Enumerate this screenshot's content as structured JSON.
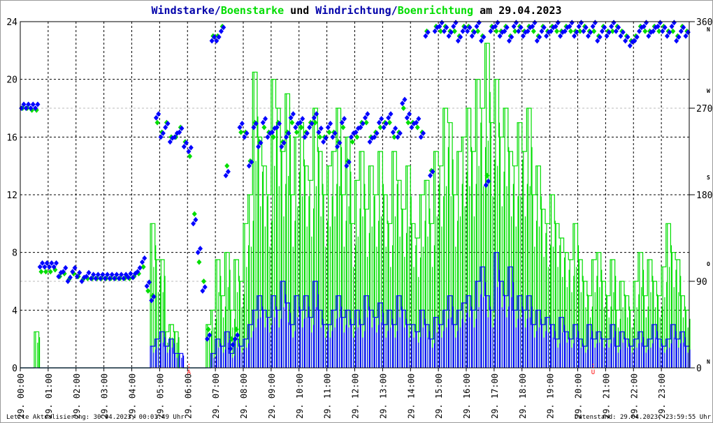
{
  "chart_data": {
    "type": "line",
    "title_parts": [
      {
        "text": "Windstarke",
        "color": "#0000aa"
      },
      {
        "text": "/",
        "color": "#0000aa"
      },
      {
        "text": "Boenstarke",
        "color": "#00dd00"
      },
      {
        "text": " und ",
        "color": "#000000"
      },
      {
        "text": "Windrichtung",
        "color": "#0000aa"
      },
      {
        "text": "/",
        "color": "#0000aa"
      },
      {
        "text": "Boenrichtung",
        "color": "#00dd00"
      },
      {
        "text": " am 29.04.2023",
        "color": "#000000"
      }
    ],
    "x_interval_minutes": 10,
    "x_tick_labels": [
      "29. 00:00",
      "29. 01:00",
      "29. 02:00",
      "29. 03:00",
      "29. 04:00",
      "29. 05:00",
      "29. 06:00",
      "29. 07:00",
      "29. 08:00",
      "29. 09:00",
      "29. 10:00",
      "29. 11:00",
      "29. 12:00",
      "29. 13:00",
      "29. 14:00",
      "29. 15:00",
      "29. 16:00",
      "29. 17:00",
      "29. 18:00",
      "29. 19:00",
      "29. 20:00",
      "29. 21:00",
      "29. 22:00",
      "29. 23:00"
    ],
    "y_left": {
      "ylim": [
        0,
        24
      ],
      "ticks": [
        "0",
        "4",
        "8",
        "12",
        "16",
        "20",
        "24"
      ]
    },
    "y_right": {
      "ylim": [
        0,
        360
      ],
      "ticks": [
        "0",
        "90",
        "180",
        "270",
        "360"
      ],
      "compass": [
        {
          "deg": 0,
          "label": "N"
        },
        {
          "deg": 90,
          "label": "O"
        },
        {
          "deg": 180,
          "label": "S"
        },
        {
          "deg": 270,
          "label": "W"
        },
        {
          "deg": 360,
          "label": "N"
        }
      ]
    },
    "markers": [
      {
        "hour": 6.05,
        "label": "A"
      },
      {
        "hour": 20.55,
        "label": "U"
      }
    ],
    "series": [
      {
        "name": "Windstarke",
        "color": "#0000ff",
        "values": [
          0,
          0,
          0,
          0,
          0,
          0,
          0,
          0,
          0,
          0,
          0,
          0,
          0,
          0,
          0,
          0,
          0,
          0,
          0,
          0,
          0,
          0,
          0,
          0,
          0,
          0,
          0,
          0,
          1.5,
          2,
          2.5,
          1.5,
          2,
          1,
          1,
          0,
          0,
          0,
          0,
          0,
          0,
          1,
          2,
          1.5,
          2.5,
          1,
          2,
          1.5,
          2,
          3,
          4,
          5,
          4,
          3.5,
          5,
          4,
          6,
          4.5,
          3,
          5,
          4,
          5,
          3.5,
          6,
          4,
          3,
          3,
          4,
          5,
          3.5,
          4,
          3,
          4,
          3,
          5,
          4,
          3.5,
          4.5,
          3,
          4,
          3,
          5,
          4,
          3,
          3,
          2.5,
          4,
          3,
          2,
          3.5,
          3,
          4,
          5,
          3,
          4,
          4.5,
          5,
          4,
          6,
          7,
          5,
          4,
          8,
          6,
          5,
          7,
          4,
          5,
          4,
          5,
          3,
          4,
          3,
          3.5,
          3,
          2,
          3.5,
          2.5,
          2,
          3,
          2,
          1.5,
          3,
          2,
          2.5,
          2,
          2,
          3,
          1.5,
          2.5,
          2,
          1.5,
          2,
          2.5,
          1.5,
          2,
          3,
          2,
          1.5,
          2,
          3,
          2,
          2.5,
          1.5
        ]
      },
      {
        "name": "Boenstarke",
        "color": "#00dd00",
        "values": [
          0,
          0,
          0,
          2.5,
          0,
          0,
          0,
          0,
          0,
          0,
          0,
          0,
          0,
          0,
          0,
          0,
          0,
          0,
          0,
          0,
          0,
          0,
          0,
          0,
          0,
          0,
          0,
          0,
          10,
          7.5,
          7.5,
          2.5,
          3,
          2.5,
          0,
          0,
          0,
          0,
          0,
          0,
          3,
          4,
          7.5,
          5,
          8,
          4,
          7.5,
          6,
          10,
          12,
          20.5,
          16,
          14,
          12,
          20,
          18,
          15,
          19,
          12,
          16,
          17,
          14,
          13,
          18,
          15,
          12,
          14,
          15,
          18,
          12,
          16,
          10,
          13,
          15,
          11,
          14,
          12,
          15,
          12,
          10,
          15,
          13,
          11,
          14,
          10,
          9,
          12,
          13,
          10,
          15,
          14,
          18,
          17,
          12,
          15,
          16,
          18,
          15,
          20,
          18,
          22.5,
          17,
          20,
          16,
          18,
          15,
          14,
          17,
          15,
          18,
          12,
          14,
          11,
          10,
          12,
          10,
          9,
          8,
          7.5,
          10,
          7.5,
          6,
          5,
          7.5,
          8,
          6,
          5,
          7.5,
          4,
          6,
          5,
          4,
          6,
          8,
          5,
          7.5,
          6,
          5,
          7,
          10,
          8,
          7.5,
          5,
          4
        ]
      },
      {
        "name": "Windrichtung",
        "color": "#0000ff",
        "unit": "deg",
        "values": [
          270,
          270,
          270,
          270,
          105,
          105,
          105,
          105,
          95,
          100,
          90,
          100,
          95,
          90,
          95,
          93,
          93,
          93,
          93,
          93,
          93,
          93,
          93,
          94,
          94,
          100,
          110,
          85,
          70,
          260,
          240,
          250,
          235,
          240,
          245,
          230,
          225,
          150,
          120,
          80,
          30,
          340,
          340,
          350,
          200,
          20,
          30,
          250,
          240,
          210,
          250,
          230,
          255,
          240,
          245,
          250,
          230,
          240,
          260,
          250,
          255,
          240,
          250,
          260,
          245,
          235,
          250,
          240,
          230,
          255,
          210,
          240,
          245,
          250,
          260,
          235,
          240,
          255,
          250,
          260,
          245,
          240,
          275,
          260,
          250,
          255,
          240,
          345,
          200,
          350,
          355,
          350,
          345,
          355,
          340,
          350,
          350,
          345,
          355,
          340,
          190,
          350,
          355,
          345,
          350,
          340,
          355,
          350,
          345,
          350,
          355,
          340,
          350,
          345,
          350,
          355,
          345,
          350,
          355,
          345,
          355,
          350,
          345,
          355,
          340,
          350,
          345,
          355,
          350,
          345,
          340,
          335,
          340,
          350,
          355,
          345,
          350,
          355,
          350,
          345,
          355,
          340,
          350,
          345
        ]
      },
      {
        "name": "Boenrichtung",
        "color": "#00dd00",
        "unit": "deg",
        "values": [
          270,
          270,
          268,
          268,
          100,
          100,
          100,
          102,
          95,
          98,
          92,
          98,
          95,
          92,
          93,
          93,
          93,
          93,
          93,
          93,
          93,
          93,
          93,
          93,
          95,
          98,
          105,
          80,
          75,
          255,
          245,
          255,
          240,
          240,
          250,
          235,
          220,
          160,
          110,
          90,
          40,
          345,
          345,
          355,
          210,
          30,
          40,
          245,
          245,
          215,
          255,
          235,
          250,
          245,
          240,
          255,
          235,
          245,
          255,
          245,
          250,
          245,
          255,
          255,
          240,
          240,
          245,
          245,
          235,
          250,
          215,
          235,
          240,
          255,
          255,
          240,
          245,
          250,
          255,
          255,
          240,
          245,
          270,
          255,
          255,
          250,
          245,
          350,
          205,
          355,
          350,
          355,
          350,
          350,
          345,
          355,
          355,
          350,
          350,
          345,
          200,
          355,
          350,
          350,
          355,
          345,
          350,
          355,
          350,
          355,
          350,
          345,
          355,
          350,
          355,
          350,
          350,
          355,
          350,
          350,
          350,
          355,
          350,
          350,
          345,
          355,
          350,
          350,
          355,
          350,
          345,
          340,
          345,
          355,
          350,
          350,
          355,
          350,
          355,
          350,
          350,
          345,
          355,
          350
        ]
      }
    ]
  },
  "footer": {
    "left": "Letzte Aktualisierung: 30.04.2023, 00:01:49 Uhr",
    "right": "Datenstand: 29.04.2023, 23:59:55 Uhr"
  }
}
